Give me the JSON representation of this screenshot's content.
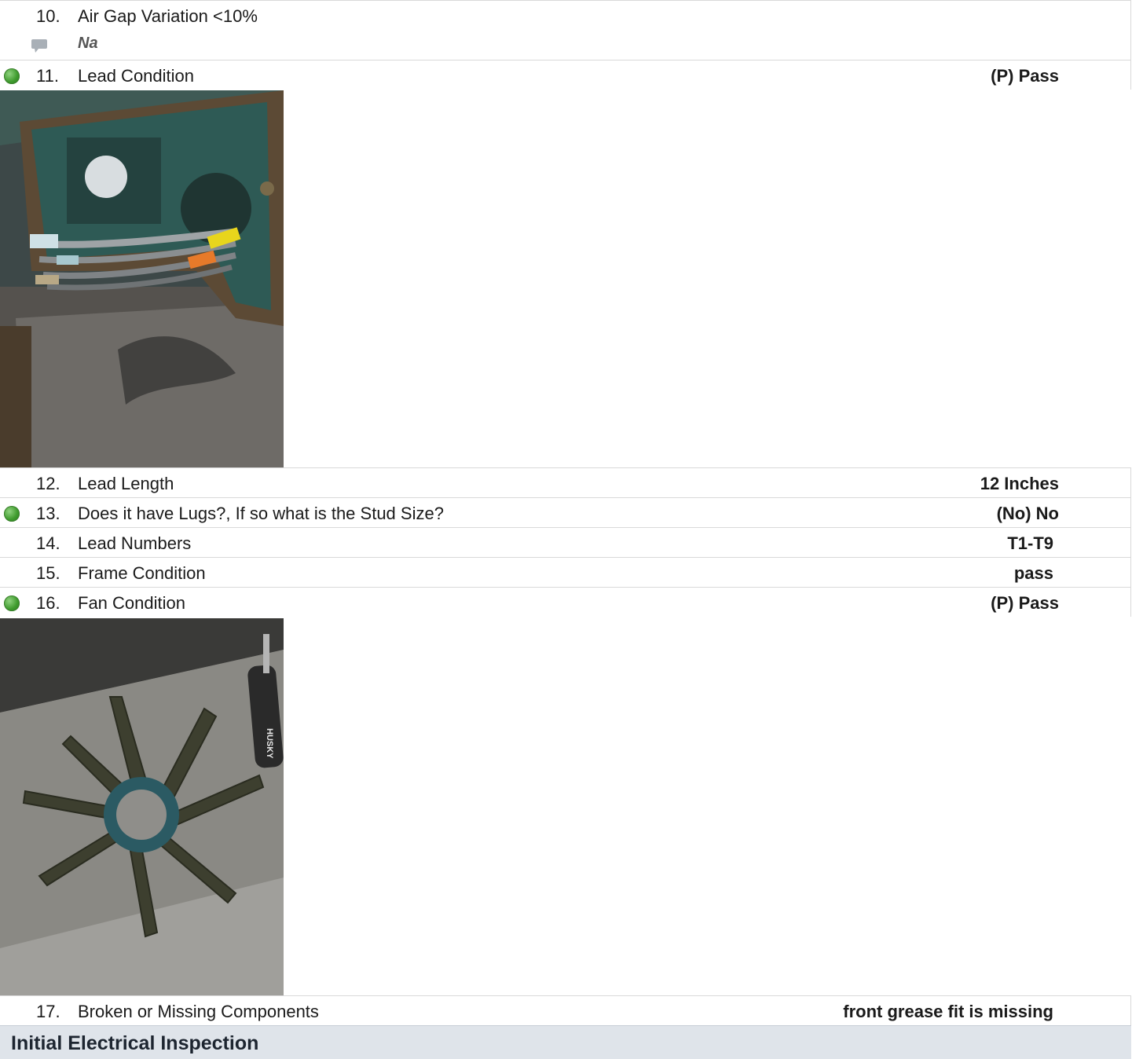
{
  "rows": [
    {
      "num": "10.",
      "label": "Air Gap Variation <10%",
      "value": "",
      "note": "Na"
    },
    {
      "num": "11.",
      "label": "Lead Condition",
      "value": "(P) Pass"
    },
    {
      "num": "12.",
      "label": "Lead Length",
      "value": "12 Inches"
    },
    {
      "num": "13.",
      "label": "Does it have Lugs?, If so what is the Stud Size?",
      "value": "(No) No"
    },
    {
      "num": "14.",
      "label": "Lead Numbers",
      "value": "T1-T9"
    },
    {
      "num": "15.",
      "label": "Frame Condition",
      "value": "pass"
    },
    {
      "num": "16.",
      "label": "Fan Condition",
      "value": "(P) Pass"
    },
    {
      "num": "17.",
      "label": "Broken or Missing Components",
      "value": "front grease fit is missing"
    }
  ],
  "photos": {
    "lead_brand": "",
    "fan_tool_brand": "HUSKY"
  },
  "section": {
    "title": "Initial Electrical Inspection"
  },
  "colors": {
    "pass_indicator": "#3f9b2e",
    "section_bg": "#dfe4ea"
  }
}
